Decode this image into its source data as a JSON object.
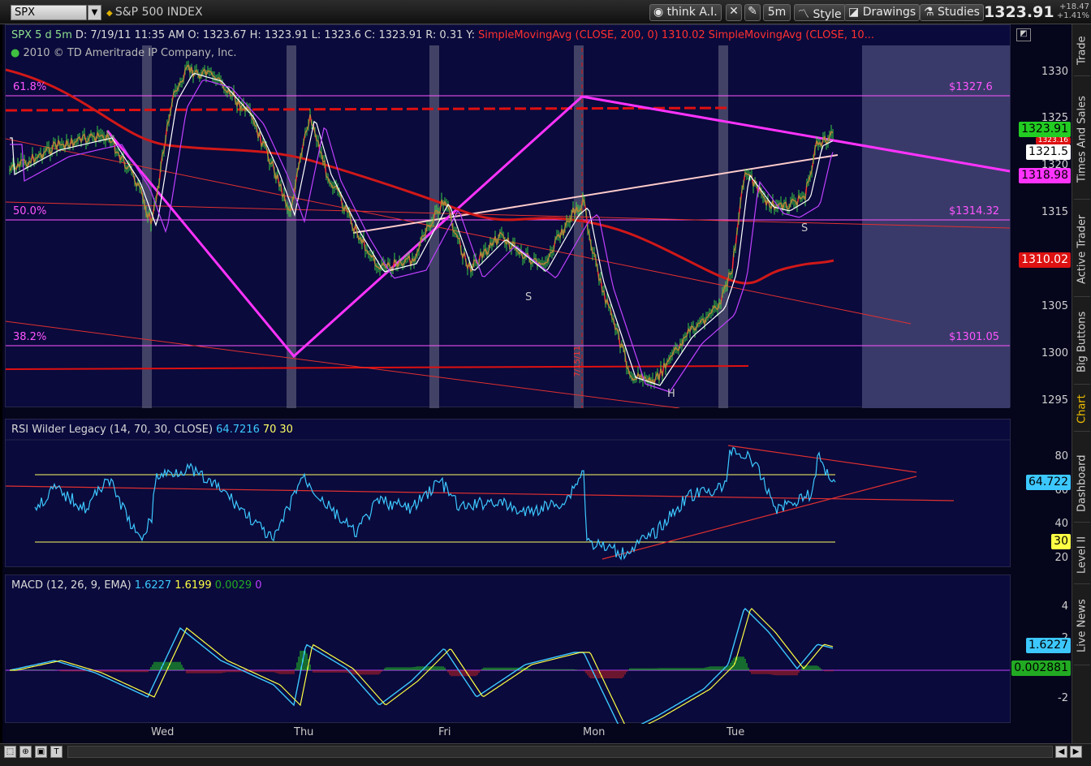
{
  "toolbar": {
    "symbol": "SPX",
    "description": "S&P 500 INDEX",
    "think_ai": "think A.I.",
    "timeframe": "5m",
    "style": "Style",
    "drawings": "Drawings",
    "studies": "Studies",
    "last_price": "1323.91",
    "change_pts": "+18.47",
    "change_pct": "+1.41%"
  },
  "header": {
    "ticker": "SPX 5 d 5m",
    "date": "D: 7/19/11 11:35 AM",
    "open": "O: 1323.67",
    "high": "H: 1323.91",
    "low": "L: 1323.6",
    "close": "C: 1323.91",
    "range": "R: 0.31",
    "y_label": "Y:",
    "sma1": "SimpleMovingAvg (CLOSE, 200, 0)",
    "sma1_val": "1310.02",
    "sma2": "SimpleMovingAvg (CLOSE, 10..."
  },
  "copyright": "2010 © TD Ameritrade IP Company, Inc.",
  "fib_labels": {
    "f618": "61.8%",
    "f50": "50.0%",
    "f382": "38.2%",
    "p618": "$1327.6",
    "p50": "$1314.32",
    "p382": "$1301.05"
  },
  "pattern_labels": {
    "s1": "S",
    "h": "H",
    "s2": "S"
  },
  "price_axis": {
    "ticks": [
      "1330",
      "1325",
      "1320",
      "1315",
      "1310",
      "1305",
      "1300",
      "1295"
    ],
    "last": "1323.91",
    "mid": "1323.16",
    "white": "1321.5",
    "magenta": "1318.98",
    "sma": "1310.02"
  },
  "rsi": {
    "title": "RSI Wilder Legacy (14, 70, 30, CLOSE)",
    "value": "64.7216",
    "ob": "70",
    "os": "30",
    "ticks": [
      "80",
      "60",
      "40",
      "20"
    ],
    "bubble": "64.722",
    "bubble_os": "30"
  },
  "macd": {
    "title": "MACD (12, 26, 9, EMA)",
    "value": "1.6227",
    "avg": "1.6199",
    "diff": "0.0029",
    "zero": "0",
    "ticks": [
      "4",
      "2",
      "-2"
    ],
    "bubble": "1.6227",
    "bubble_diff": "0.002881"
  },
  "time_axis": [
    "Wed",
    "Thu",
    "Fri",
    "Mon",
    "Tue"
  ],
  "date_marker": "7/15/11",
  "side_tabs": [
    "Trade",
    "Times And Sales",
    "Active Trader",
    "Big Buttons",
    "Chart",
    "Dashboard",
    "Level II",
    "Live News"
  ],
  "colors": {
    "bg": "#0a0a3c",
    "magenta": "#ff33ff",
    "red": "#e01010",
    "rsi": "#3cc8ff",
    "yellow": "#ffff66"
  }
}
